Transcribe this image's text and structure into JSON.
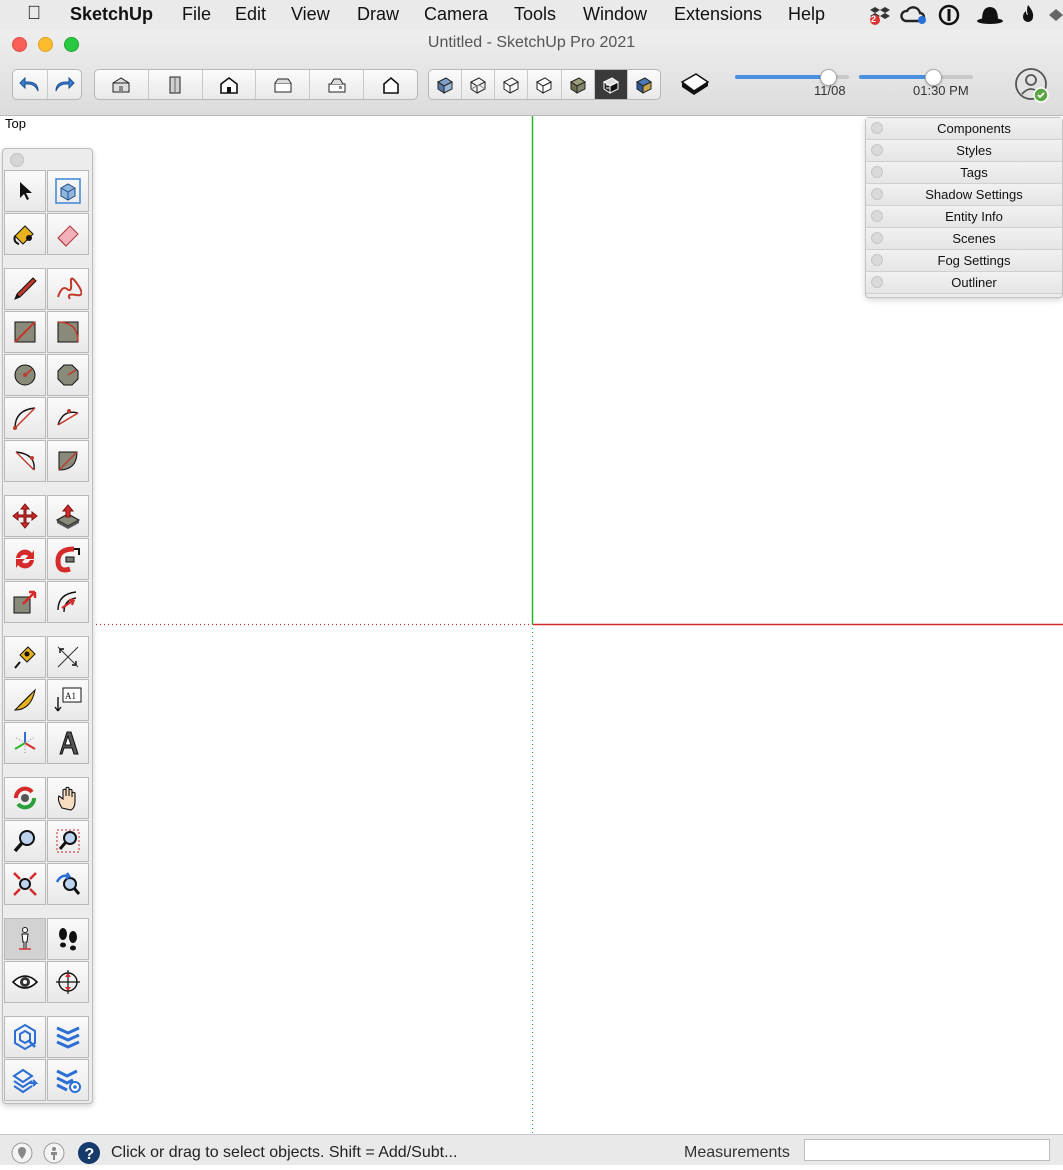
{
  "menubar": {
    "app_name": "SketchUp",
    "items": [
      "File",
      "Edit",
      "View",
      "Draw",
      "Camera",
      "Tools",
      "Window",
      "Extensions",
      "Help"
    ],
    "tray_icons": [
      "dropbox-icon",
      "creative-cloud-icon",
      "1password-icon",
      "bowler-hat-icon",
      "flame-icon",
      "diamond-icon"
    ],
    "dropbox_badge": "2"
  },
  "window": {
    "title": "Untitled - SketchUp Pro 2021"
  },
  "toolbar": {
    "edit_buttons": [
      "undo-icon",
      "redo-icon"
    ],
    "view_buttons": [
      "iso-view-icon",
      "top-view-icon",
      "front-view-icon",
      "right-view-icon",
      "back-view-icon",
      "left-view-icon"
    ],
    "style_buttons": [
      "xray-style-icon",
      "wireframe-style-icon",
      "hidden-line-style-icon",
      "shaded-style-icon",
      "shaded-textures-style-icon",
      "monochrome-style-icon",
      "xray-shaded-style-icon"
    ],
    "shadow_toggle": "shadows-icon",
    "date_label": "11/08",
    "time_label": "01:30 PM",
    "date_slider_value": 0.82,
    "time_slider_value": 0.65,
    "account_icon": "trimble-account-icon"
  },
  "viewport": {
    "view_name": "Top",
    "axis_colors": {
      "green": "#2bb52b",
      "red": "#d42a2a"
    }
  },
  "tool_palette": {
    "groups": [
      [
        "select-tool-icon",
        "make-component-icon",
        "paint-bucket-icon",
        "eraser-icon"
      ],
      [
        "line-tool-icon",
        "freehand-tool-icon",
        "rectangle-tool-icon",
        "rotated-rectangle-icon",
        "circle-tool-icon",
        "polygon-tool-icon",
        "arc-tool-icon",
        "two-point-arc-icon",
        "three-point-arc-icon",
        "pie-tool-icon"
      ],
      [
        "move-tool-icon",
        "push-pull-icon",
        "rotate-tool-icon",
        "follow-me-icon",
        "scale-tool-icon",
        "offset-tool-icon"
      ],
      [
        "tape-measure-icon",
        "dimension-tool-icon",
        "protractor-icon",
        "text-tool-icon",
        "axes-tool-icon",
        "3d-text-icon"
      ],
      [
        "orbit-tool-icon",
        "pan-tool-icon",
        "zoom-tool-icon",
        "zoom-window-icon",
        "zoom-extents-icon",
        "previous-view-icon"
      ],
      [
        "position-camera-icon",
        "walk-tool-icon",
        "look-around-icon",
        "section-plane-icon"
      ],
      [
        "3d-warehouse-icon",
        "extension-warehouse-icon",
        "layout-send-icon",
        "extension-manager-icon"
      ]
    ],
    "text_tool_label": "A1"
  },
  "tray": {
    "panels": [
      "Components",
      "Styles",
      "Tags",
      "Shadow Settings",
      "Entity Info",
      "Scenes",
      "Fog Settings",
      "Outliner"
    ]
  },
  "statusbar": {
    "message": "Click or drag to select objects. Shift = Add/Subt...",
    "measurements_label": "Measurements",
    "measurements_value": ""
  }
}
